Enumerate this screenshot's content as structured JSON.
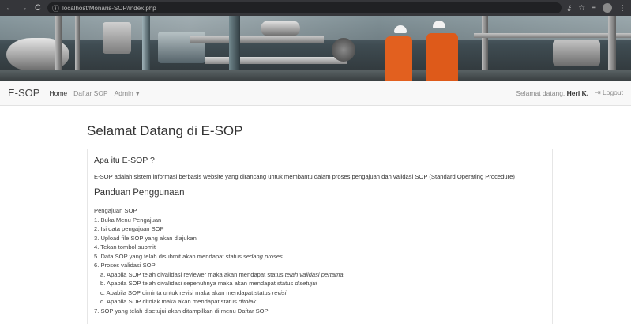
{
  "browser": {
    "url": "localhost/Monaris-SOP/index.php"
  },
  "navbar": {
    "brand": "E-SOP",
    "links": [
      "Home",
      "Daftar SOP",
      "Admin"
    ],
    "welcome_prefix": "Selamat datang,",
    "user_name": "Heri K.",
    "logout": "Logout"
  },
  "main": {
    "title": "Selamat Datang di E-SOP",
    "what_heading": "Apa itu E-SOP ?",
    "what_text": "E-SOP adalah sistem informasi berbasis website yang dirancang untuk membantu dalam proses pengajuan dan validasi SOP (Standard Operating Procedure)",
    "guide_heading": "Panduan Penggunaan",
    "steps": {
      "header": "Pengajuan SOP",
      "s1": "1. Buka Menu Pengajuan",
      "s2": "2. Isi data pengajuan SOP",
      "s3": "3. Upload file SOP yang akan diajukan",
      "s4": "4. Tekan tombol submit",
      "s5_prefix": "5. Data SOP yang telah disubmit akan mendapat status ",
      "s5_em": "sedang proses",
      "s6": "6. Proses validasi SOP",
      "a_prefix": "a. Apabila SOP telah divalidasi reviewer maka akan mendapat status ",
      "a_em": "telah validasi pertama",
      "b_prefix": "b. Apabila SOP telah divalidasi sepenuhnya maka akan mendapat status ",
      "b_em": "disetujui",
      "c_prefix": "c. Apabila SOP diminta untuk revisi maka akan mendapat status ",
      "c_em": "revisi",
      "d_prefix": "d. Apabila SOP ditolak maka akan mendapat status ",
      "d_em": "ditolak",
      "s7": "7. SOP yang telah disetujui akan ditampilkan di menu Daftar SOP"
    }
  }
}
